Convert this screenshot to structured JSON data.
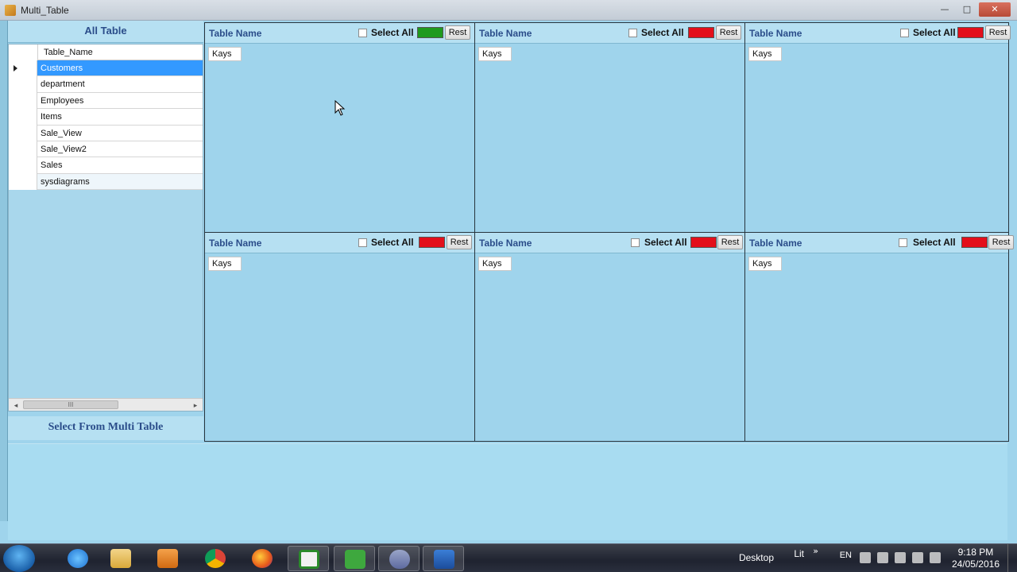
{
  "window": {
    "title": "Multi_Table",
    "controls": {
      "minimize": "—",
      "maximize": "□",
      "close": "✕"
    }
  },
  "left_panel": {
    "header": "All Table",
    "grid_column": "Table_Name",
    "rows": [
      "Customers",
      "department",
      "Employees",
      "Items",
      "Sale_View",
      "Sale_View2",
      "Sales",
      "sysdiagrams"
    ],
    "selected_row": "Customers",
    "scroll_thumb": "III",
    "scroll_left": "◂",
    "scroll_right": "▸",
    "footer_button": "Select From Multi Table"
  },
  "panels": [
    {
      "name": "Table Name",
      "select_all": "Select All",
      "color": "#1e9a1e",
      "rest": "Rest",
      "kays": "Kays"
    },
    {
      "name": "Table Name",
      "select_all": "Select All",
      "color": "#e30f1b",
      "rest": "Rest",
      "kays": "Kays"
    },
    {
      "name": "Table Name",
      "select_all": "Select All",
      "color": "#e30f1b",
      "rest": "Rest",
      "kays": "Kays"
    },
    {
      "name": "Table Name",
      "select_all": "Select All",
      "color": "#e30f1b",
      "rest": "Rest",
      "kays": "Kays"
    },
    {
      "name": "Table Name",
      "select_all": "Select All",
      "color": "#e30f1b",
      "rest": "Rest",
      "kays": "Kays"
    },
    {
      "name": "Table Name",
      "select_all": "Select All",
      "color": "#e30f1b",
      "rest": "Rest",
      "kays": "Kays"
    }
  ],
  "taskbar": {
    "items": [
      "start-orb",
      "internet-explorer",
      "file-explorer",
      "media-player",
      "chrome",
      "firefox",
      "camtasia-recorder",
      "camtasia-studio",
      "visual-studio",
      "sql-server"
    ],
    "tray": {
      "desktop": "Desktop",
      "libraries": "Lit",
      "overflow": "»",
      "language": "EN",
      "time": "9:18 PM",
      "date": "24/05/2016"
    }
  }
}
